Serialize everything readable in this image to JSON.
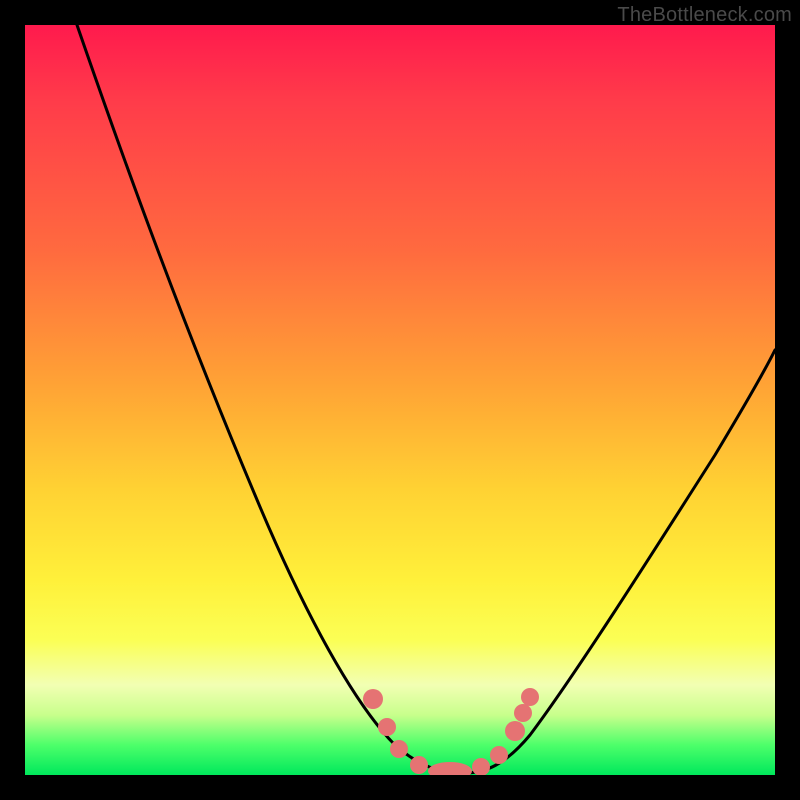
{
  "watermark": "TheBottleneck.com",
  "chart_data": {
    "type": "line",
    "title": "",
    "xlabel": "",
    "ylabel": "",
    "xlim": [
      0,
      100
    ],
    "ylim": [
      0,
      100
    ],
    "background_gradient": {
      "direction": "top-to-bottom",
      "stops": [
        {
          "pct": 0,
          "color": "#ff1a4d"
        },
        {
          "pct": 30,
          "color": "#ff6a3f"
        },
        {
          "pct": 62,
          "color": "#ffd233"
        },
        {
          "pct": 88,
          "color": "#f2ffb3"
        },
        {
          "pct": 100,
          "color": "#00e85c"
        }
      ]
    },
    "series": [
      {
        "name": "bottleneck-curve",
        "color": "#000000",
        "x": [
          7,
          10,
          15,
          20,
          25,
          30,
          35,
          40,
          44,
          48,
          50,
          52,
          55,
          58,
          62,
          65,
          70,
          75,
          80,
          85,
          90,
          95,
          100
        ],
        "y": [
          100,
          92,
          80,
          68,
          57,
          46,
          36,
          26,
          16,
          8,
          3,
          1,
          0,
          0,
          1,
          4,
          10,
          18,
          27,
          35,
          43,
          50,
          56
        ]
      }
    ],
    "markers": {
      "name": "highlighted-points",
      "color": "#e57373",
      "points": [
        {
          "x": 47,
          "y": 11
        },
        {
          "x": 49,
          "y": 6
        },
        {
          "x": 50,
          "y": 3
        },
        {
          "x": 53,
          "y": 1
        },
        {
          "x": 55,
          "y": 0.5
        },
        {
          "x": 57,
          "y": 0.5
        },
        {
          "x": 59,
          "y": 0.5
        },
        {
          "x": 61,
          "y": 1
        },
        {
          "x": 63,
          "y": 3
        },
        {
          "x": 65,
          "y": 7
        },
        {
          "x": 66,
          "y": 10
        }
      ]
    }
  }
}
